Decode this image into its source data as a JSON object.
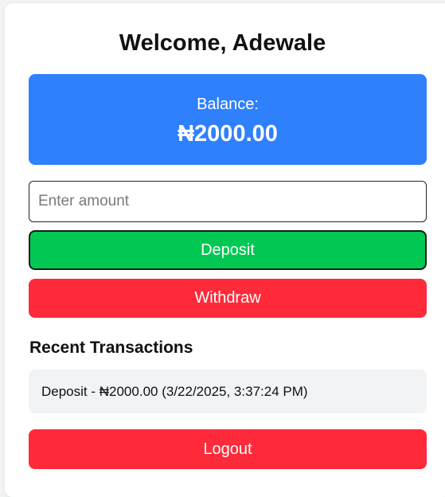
{
  "header": {
    "title": "Welcome, Adewale"
  },
  "balance": {
    "label": "Balance:",
    "amount": "₦2000.00"
  },
  "amount_input": {
    "value": "",
    "placeholder": "Enter amount"
  },
  "actions": {
    "deposit_label": "Deposit",
    "withdraw_label": "Withdraw",
    "logout_label": "Logout"
  },
  "transactions": {
    "title": "Recent Transactions",
    "items": [
      {
        "text": "Deposit - ₦2000.00 (3/22/2025, 3:37:24 PM)"
      }
    ]
  },
  "colors": {
    "balance_bg": "#2f80fd",
    "deposit_bg": "#00c853",
    "withdraw_bg": "#ff2a3a",
    "logout_bg": "#ff2a3a",
    "transaction_bg": "#f2f3f5"
  }
}
